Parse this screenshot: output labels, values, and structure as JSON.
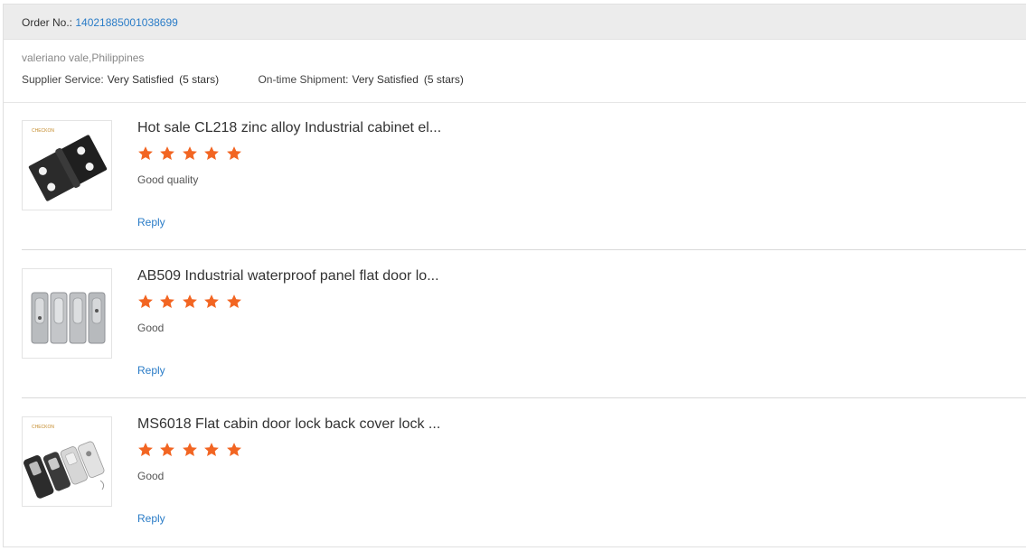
{
  "order": {
    "label": "Order No.:",
    "number": "14021885001038699"
  },
  "buyer": "valeriano vale,Philippines",
  "ratings": [
    {
      "label": "Supplier Service:",
      "value": "Very Satisfied",
      "stars": "(5 stars)"
    },
    {
      "label": "On-time Shipment:",
      "value": "Very Satisfied",
      "stars": "(5 stars)"
    }
  ],
  "items": [
    {
      "title": "Hot sale CL218 zinc alloy Industrial cabinet el...",
      "rating": 5,
      "comment": "Good quality",
      "reply": "Reply",
      "image": "black-hinge-image"
    },
    {
      "title": "AB509 Industrial waterproof panel flat door lo...",
      "rating": 5,
      "comment": "Good",
      "reply": "Reply",
      "image": "silver-panel-locks-image"
    },
    {
      "title": "MS6018 Flat cabin door lock back cover lock ...",
      "rating": 5,
      "comment": "Good",
      "reply": "Reply",
      "image": "cabin-door-locks-image"
    }
  ],
  "colors": {
    "link": "#2a7cc7",
    "star": "#f26522",
    "header_bg": "#ececec"
  }
}
